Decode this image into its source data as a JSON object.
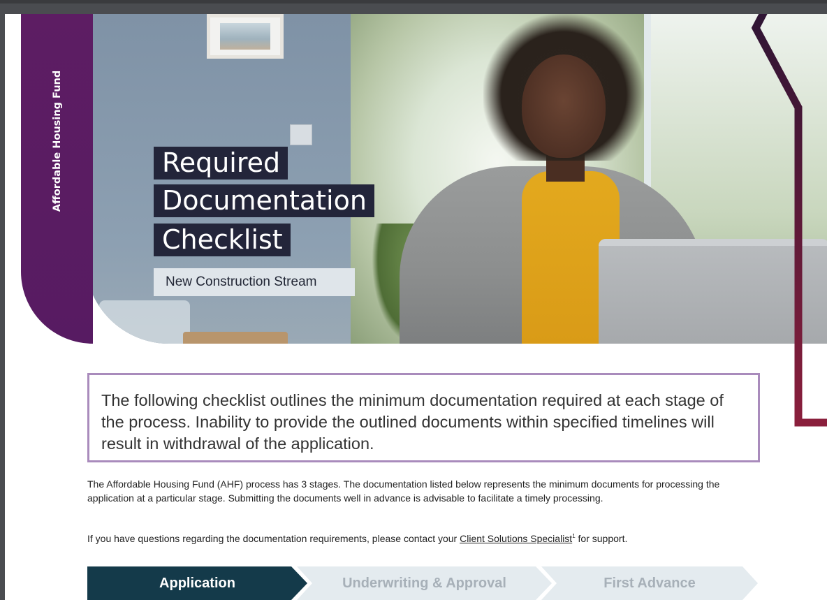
{
  "sidebar_label": "Affordable Housing Fund",
  "title_lines": [
    "Required",
    "Documentation",
    "Checklist"
  ],
  "subtitle": "New Construction Stream",
  "callout_text": "The following checklist outlines the minimum documentation required at each stage of the process. Inability to provide the outlined documents within specified timelines will result in withdrawal of the application.",
  "intro_paragraph": "The Affordable Housing Fund (AHF) process has 3 stages. The documentation listed below represents the minimum documents for processing the application at a particular stage. Submitting the documents well in advance is advisable to facilitate a timely processing.",
  "contact": {
    "before": "If you have questions regarding the documentation requirements, please contact your ",
    "link_text": "Client Solutions Specialist",
    "footnote_mark": "1",
    "after": " for support."
  },
  "process_steps": [
    {
      "label": "Application",
      "state": "active"
    },
    {
      "label": "Underwriting & Approval",
      "state": "inactive"
    },
    {
      "label": "First Advance",
      "state": "inactive"
    }
  ],
  "colors": {
    "brand_purple": "#5d1d63",
    "title_background": "#23253a",
    "callout_border": "#a98bbc",
    "active_step": "#143a4a",
    "inactive_step": "#e4ebef",
    "deco_line_gradient": [
      "#2a1434",
      "#8a1f3c"
    ]
  },
  "illustration": "photo-woman-using-laptop"
}
